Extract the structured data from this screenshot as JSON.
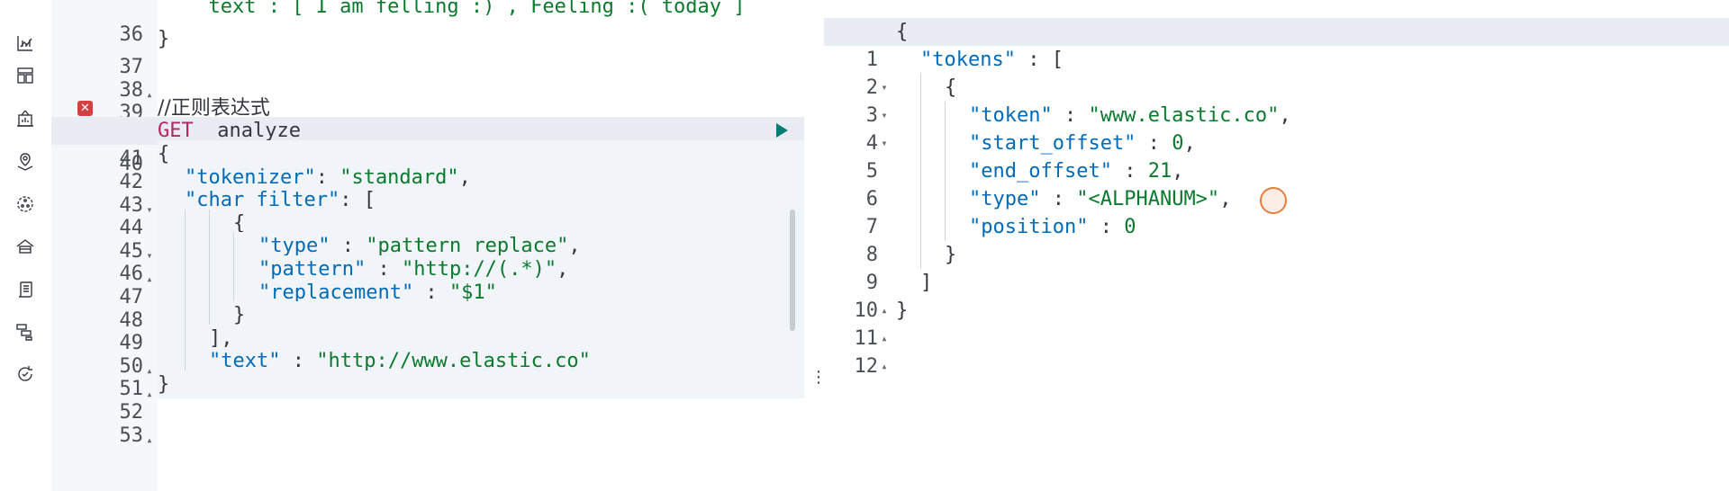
{
  "nav": {
    "icons": [
      {
        "name": "overview-icon"
      },
      {
        "name": "dashboard-icon"
      },
      {
        "name": "canvas-icon"
      },
      {
        "name": "maps-icon"
      },
      {
        "name": "ml-icon"
      },
      {
        "name": "infrastructure-icon"
      },
      {
        "name": "logs-icon"
      },
      {
        "name": "apm-icon"
      },
      {
        "name": "uptime-icon"
      }
    ]
  },
  "request_editor": {
    "lines": [
      {
        "n": "36",
        "text": "  text : [ I am felling :) , Feeling :( today ]"
      },
      {
        "n": "37",
        "fold": "▴",
        "text": "}"
      },
      {
        "n": "38",
        "text": ""
      },
      {
        "n": "39",
        "text": ""
      },
      {
        "n": "40",
        "text": "//正则表达式",
        "error": "✕"
      },
      {
        "n": "41",
        "method": "GET",
        "path": "_analyze"
      },
      {
        "n": "42",
        "fold": "▾",
        "text": "{"
      },
      {
        "n": "43",
        "key": "\"tokenizer\"",
        "sep": ": ",
        "val": "\"standard\"",
        "tail": ","
      },
      {
        "n": "44",
        "fold": "▾",
        "key": "\"char_filter\"",
        "sep": ": ",
        "tail": "["
      },
      {
        "n": "45",
        "fold": "▴",
        "text": "{"
      },
      {
        "n": "46",
        "key": "\"type\"",
        "sep": " : ",
        "val": "\"pattern_replace\"",
        "tail": ","
      },
      {
        "n": "47",
        "key": "\"pattern\"",
        "sep": " : ",
        "val": "\"http://(.*)\"",
        "tail": ","
      },
      {
        "n": "48",
        "key": "\"replacement\"",
        "sep": " : ",
        "val": "\"$1\""
      },
      {
        "n": "49",
        "fold": "▴",
        "text": "}"
      },
      {
        "n": "50",
        "fold": "▴",
        "text": "],"
      },
      {
        "n": "51",
        "key": "\"text\"",
        "sep": " : ",
        "val": "\"http://www.elastic.co\""
      },
      {
        "n": "52",
        "fold": "▴",
        "text": "}"
      },
      {
        "n": "53",
        "text": ""
      }
    ]
  },
  "response_viewer": {
    "lines": [
      {
        "n": "1",
        "fold": "▾",
        "text": "{"
      },
      {
        "n": "2",
        "fold": "▾",
        "key": "\"tokens\"",
        "sep": " : ",
        "tail": "["
      },
      {
        "n": "3",
        "fold": "▾",
        "text": "{"
      },
      {
        "n": "4",
        "key": "\"token\"",
        "sep": " : ",
        "val": "\"www.elastic.co\"",
        "tail": ","
      },
      {
        "n": "5",
        "key": "\"start_offset\"",
        "sep": " : ",
        "num": "0",
        "tail": ","
      },
      {
        "n": "6",
        "key": "\"end_offset\"",
        "sep": " : ",
        "num": "21",
        "tail": ","
      },
      {
        "n": "7",
        "key": "\"type\"",
        "sep": " : ",
        "val": "\"<ALPHANUM>\"",
        "tail": ","
      },
      {
        "n": "8",
        "key": "\"position\"",
        "sep": " : ",
        "num": "0"
      },
      {
        "n": "9",
        "fold": "▴",
        "text": "}"
      },
      {
        "n": "10",
        "fold": "▴",
        "text": "]"
      },
      {
        "n": "11",
        "fold": "▴",
        "text": "}"
      },
      {
        "n": "12",
        "text": ""
      }
    ]
  },
  "actions": {
    "run_icon": "play-icon",
    "settings_icon": "wrench-icon",
    "run_glyph": "▶",
    "settings_glyph": "🔧"
  },
  "splitter": {
    "glyph": "⋮"
  },
  "colors": {
    "method": "#b5265f",
    "key": "#006bb8",
    "string": "#0a7a2d",
    "accent": "#0071c2",
    "run": "#017d73"
  }
}
